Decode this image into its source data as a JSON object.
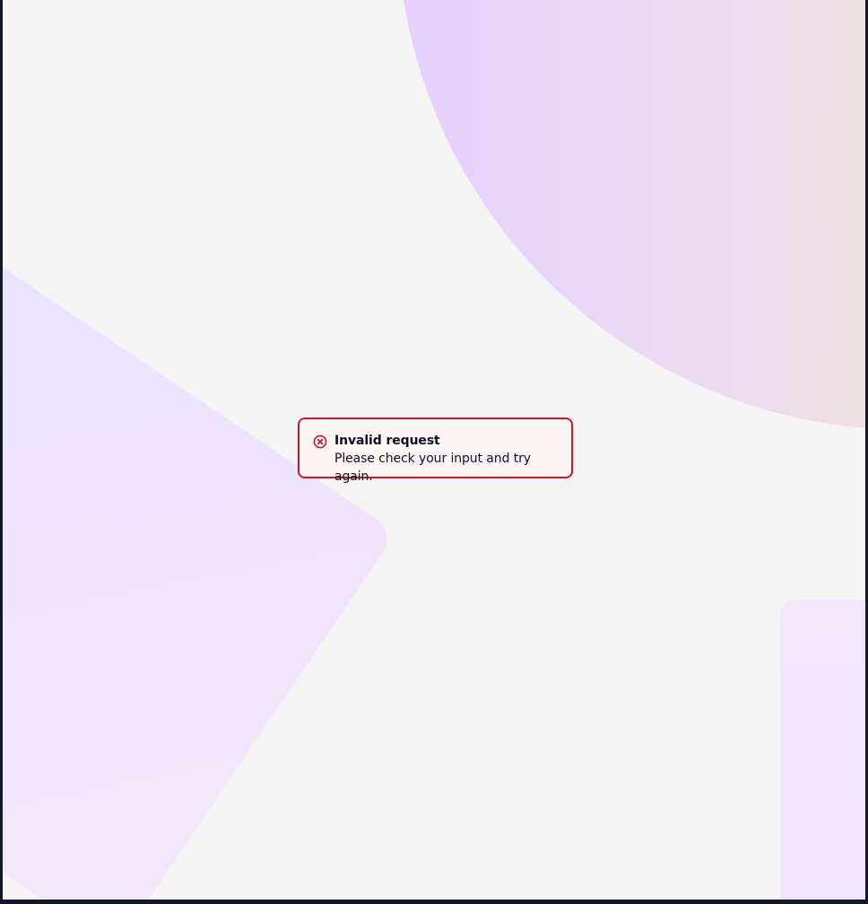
{
  "alert": {
    "type": "error",
    "icon": "error-circle-x-icon",
    "title": "Invalid request",
    "message": "Please check your input and try again.",
    "colors": {
      "border": "#c9182a",
      "background": "#fdf4f4",
      "text": "#0d1024"
    }
  },
  "background": {
    "colors": {
      "page": "#f4f4f4",
      "frame": "#141726",
      "accent_purple": "#e6ceff",
      "accent_peach": "#f7edc8",
      "accent_lavender": "#efe3fb"
    }
  }
}
